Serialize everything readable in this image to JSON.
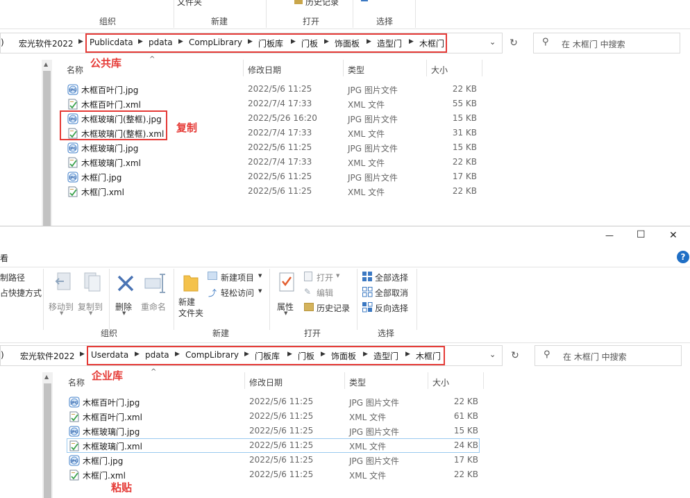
{
  "top": {
    "ribbon": {
      "partial_file_label": "文件夹",
      "partial_history": "历史记录",
      "group_labels": [
        "组织",
        "新建",
        "打开",
        "选择"
      ]
    },
    "breadcrumbs": [
      "宏光软件2022",
      "Publicdata",
      "pdata",
      "CompLibrary",
      "门板库",
      "门板",
      "饰面板",
      "造型门",
      "木框门"
    ],
    "search_placeholder": "在 木框门 中搜索",
    "annotation_library": "公共库",
    "annotation_copy": "复制",
    "columns": [
      "名称",
      "修改日期",
      "类型",
      "大小"
    ],
    "files": [
      {
        "name": "木框百叶门.jpg",
        "date": "2022/5/6 11:25",
        "type": "JPG 图片文件",
        "size": "22 KB",
        "icon": "jpg"
      },
      {
        "name": "木框百叶门.xml",
        "date": "2022/7/4 17:33",
        "type": "XML 文件",
        "size": "55 KB",
        "icon": "xml"
      },
      {
        "name": "木框玻璃门(整框).jpg",
        "date": "2022/5/26 16:20",
        "type": "JPG 图片文件",
        "size": "15 KB",
        "icon": "jpg"
      },
      {
        "name": "木框玻璃门(整框).xml",
        "date": "2022/7/4 17:33",
        "type": "XML 文件",
        "size": "31 KB",
        "icon": "xml"
      },
      {
        "name": "木框玻璃门.jpg",
        "date": "2022/5/6 11:25",
        "type": "JPG 图片文件",
        "size": "15 KB",
        "icon": "jpg"
      },
      {
        "name": "木框玻璃门.xml",
        "date": "2022/7/4 17:33",
        "type": "XML 文件",
        "size": "22 KB",
        "icon": "xml"
      },
      {
        "name": "木框门.jpg",
        "date": "2022/5/6 11:25",
        "type": "JPG 图片文件",
        "size": "17 KB",
        "icon": "jpg"
      },
      {
        "name": "木框门.xml",
        "date": "2022/5/6 11:25",
        "type": "XML 文件",
        "size": "22 KB",
        "icon": "xml"
      }
    ]
  },
  "bottom": {
    "window_controls": {
      "minimize": "—",
      "maximize": "☐",
      "close": "✕",
      "help": "?"
    },
    "partial_tab": "看",
    "ribbon": {
      "copy_path": "制路径",
      "paste_shortcut": "占快捷方式",
      "move_to": "移动到",
      "copy_to": "复制到",
      "delete": "删除",
      "rename": "重命名",
      "new_folder": "新建\n文件夹",
      "new_item": "新建项目",
      "easy_access": "轻松访问",
      "properties": "属性",
      "open": "打开",
      "edit": "编辑",
      "history": "历史记录",
      "select_all": "全部选择",
      "select_none": "全部取消",
      "invert_selection": "反向选择",
      "group_labels": [
        "组织",
        "新建",
        "打开",
        "选择"
      ]
    },
    "breadcrumbs": [
      "宏光软件2022",
      "Userdata",
      "pdata",
      "CompLibrary",
      "门板库",
      "门板",
      "饰面板",
      "造型门",
      "木框门"
    ],
    "search_placeholder": "在 木框门 中搜索",
    "annotation_library": "企业库",
    "annotation_paste": "粘贴",
    "columns": [
      "名称",
      "修改日期",
      "类型",
      "大小"
    ],
    "files": [
      {
        "name": "木框百叶门.jpg",
        "date": "2022/5/6 11:25",
        "type": "JPG 图片文件",
        "size": "22 KB",
        "icon": "jpg"
      },
      {
        "name": "木框百叶门.xml",
        "date": "2022/5/6 11:25",
        "type": "XML 文件",
        "size": "61 KB",
        "icon": "xml"
      },
      {
        "name": "木框玻璃门.jpg",
        "date": "2022/5/6 11:25",
        "type": "JPG 图片文件",
        "size": "15 KB",
        "icon": "jpg"
      },
      {
        "name": "木框玻璃门.xml",
        "date": "2022/5/6 11:25",
        "type": "XML 文件",
        "size": "24 KB",
        "icon": "xml"
      },
      {
        "name": "木框门.jpg",
        "date": "2022/5/6 11:25",
        "type": "JPG 图片文件",
        "size": "17 KB",
        "icon": "jpg"
      },
      {
        "name": "木框门.xml",
        "date": "2022/5/6 11:25",
        "type": "XML 文件",
        "size": "22 KB",
        "icon": "xml"
      }
    ]
  },
  "colors": {
    "annotation_red": "#e53935",
    "selection_border": "#99c9ef"
  }
}
